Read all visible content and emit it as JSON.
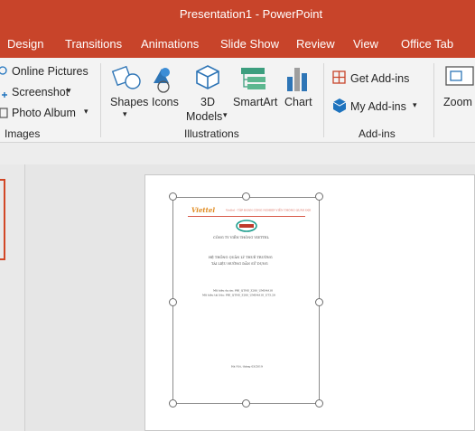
{
  "window": {
    "title": "Presentation1  -  PowerPoint"
  },
  "tabs": [
    "Design",
    "Transitions",
    "Animations",
    "Slide Show",
    "Review",
    "View",
    "Office Tab"
  ],
  "ribbon": {
    "images": {
      "online_pictures": "Online Pictures",
      "screenshot": "Screenshot",
      "photo_album": "Photo Album",
      "label": "Images"
    },
    "illustrations": {
      "shapes": "Shapes",
      "icons": "Icons",
      "models_3d_line1": "3D",
      "models_3d_line2": "Models",
      "smartart": "SmartArt",
      "chart": "Chart",
      "label": "Illustrations"
    },
    "addins": {
      "get": "Get Add-ins",
      "my": "My Add-ins",
      "label": "Add-ins"
    },
    "zoom": "Zoom"
  },
  "document": {
    "brand": "Viettel",
    "header_line": "Viettel - TẬP ĐOÀN CÔNG NGHIỆP VIỄN THÔNG QUÂN ĐỘI",
    "company": "CÔNG TY VIỄN THÔNG VIETTEL",
    "system_line1": "HỆ THỐNG QUẢN LÝ THUÊ TRƯỜNG",
    "system_line2": "TÀI LIỆU HƯỚNG DẪN SỬ DỤNG",
    "code1": "Mã hiệu dự án: PBI_QTHS_3280_UMS4A18",
    "code2": "Mã hiệu tài liệu: PBI_QTHS_3280_UMS4A18_UT3.29",
    "footer": "Hà Nội, tháng 03/2019"
  },
  "colors": {
    "accent": "#c8442a",
    "selection": "#d24726",
    "addin_icon": "#1e73be"
  }
}
